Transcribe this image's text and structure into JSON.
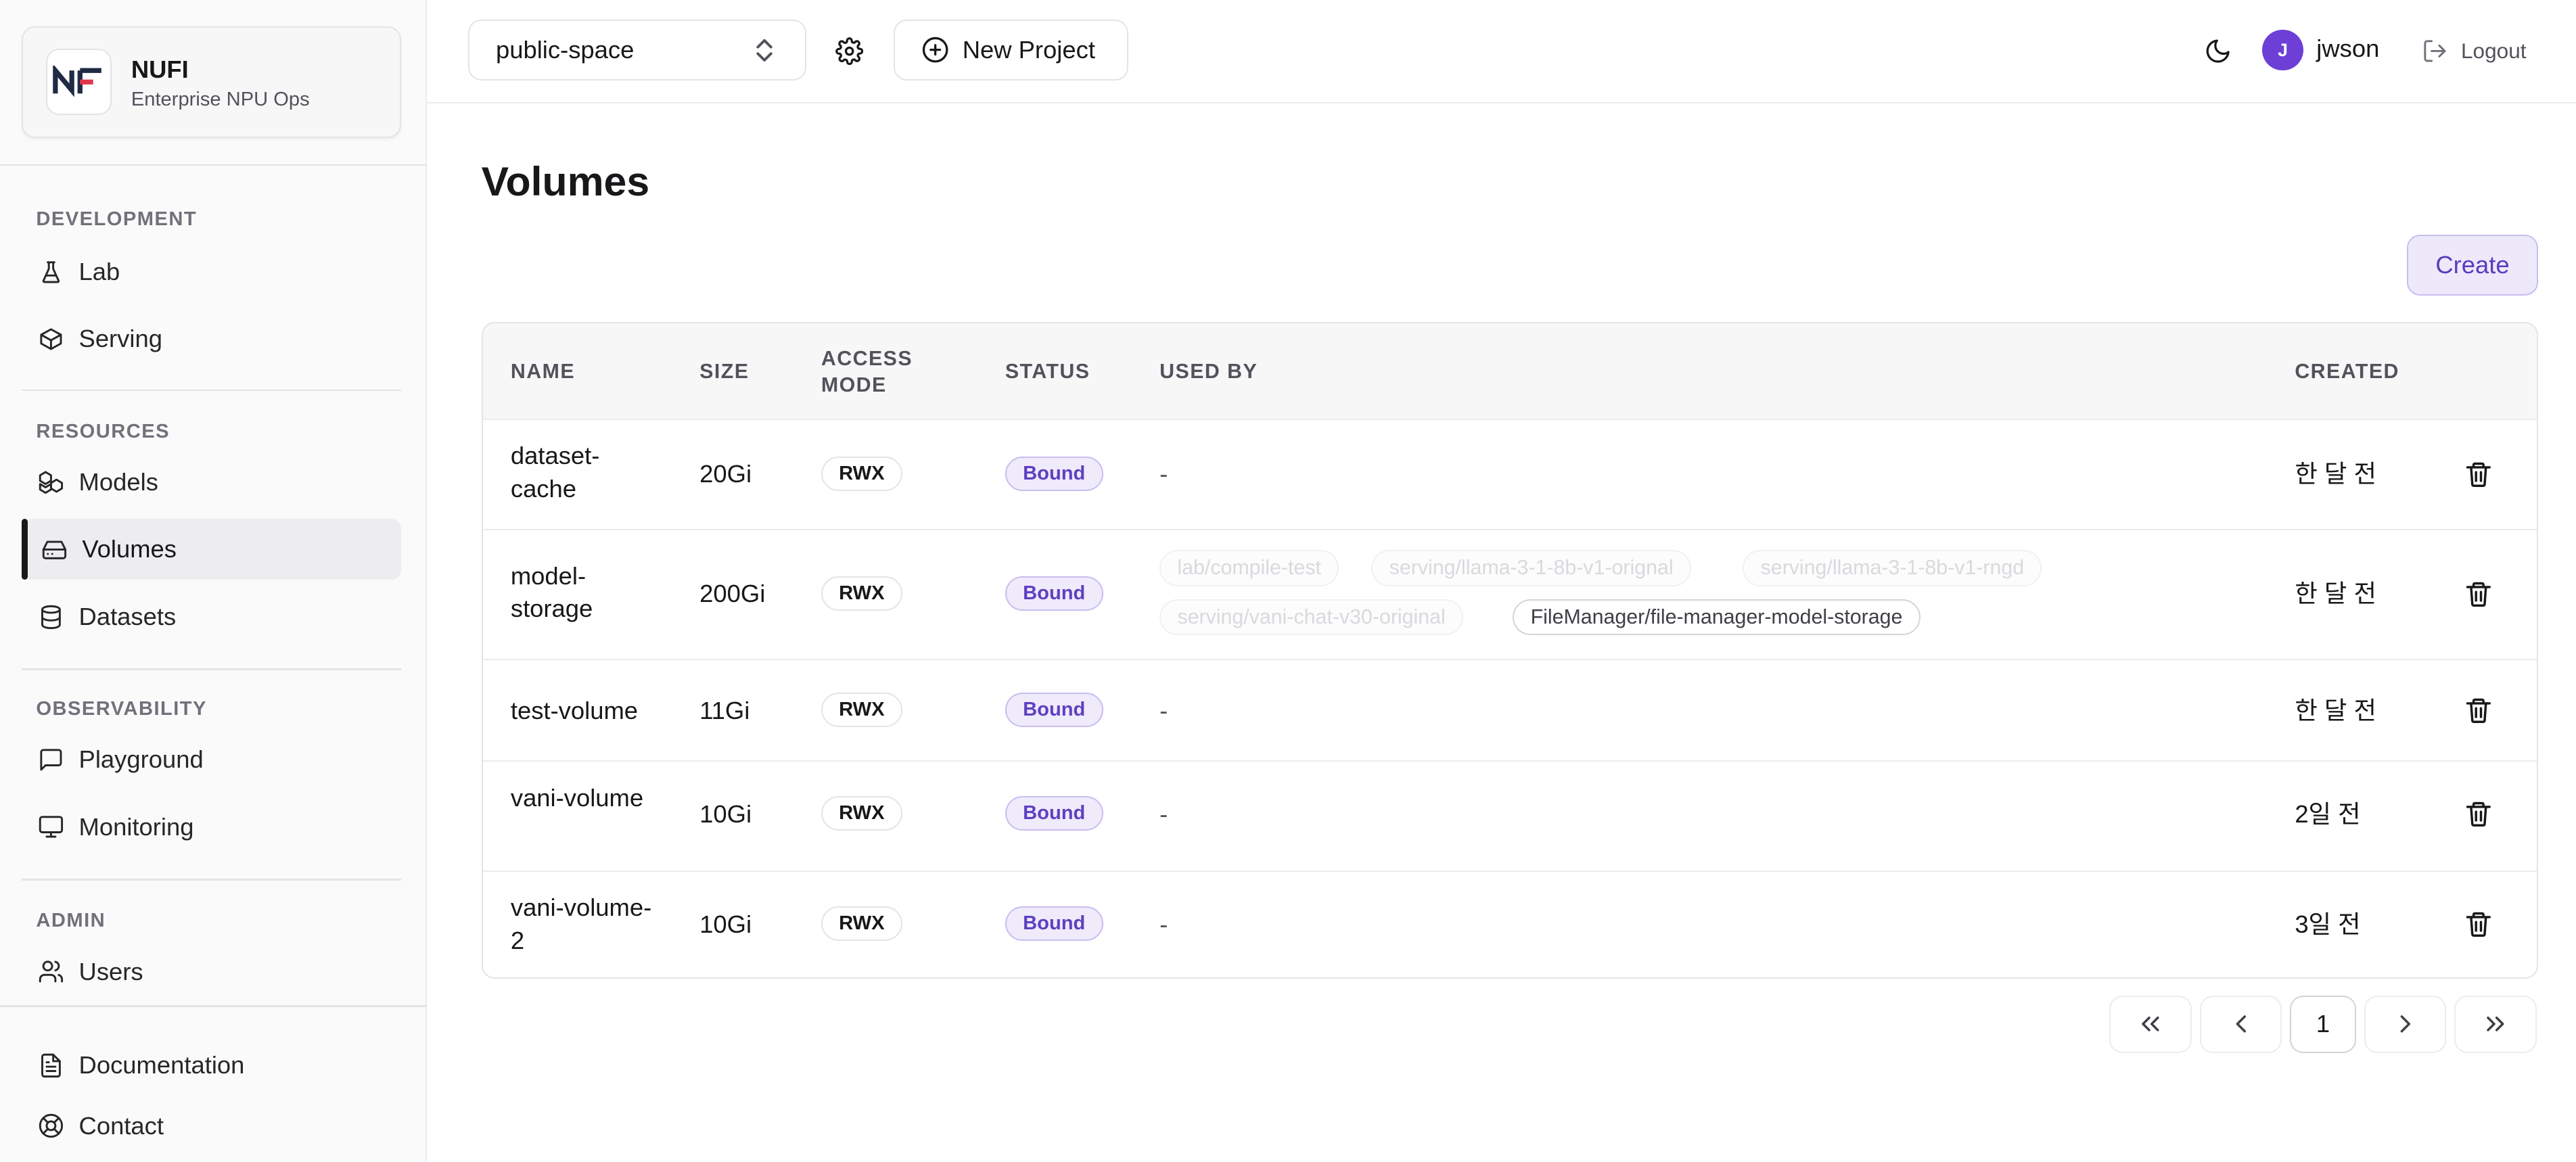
{
  "brand": {
    "logo_text": "NF",
    "name": "NUFI",
    "subtitle": "Enterprise NPU Ops"
  },
  "sidebar": {
    "sections": [
      {
        "label": "DEVELOPMENT",
        "items": [
          {
            "label": "Lab",
            "icon": "flask-icon"
          },
          {
            "label": "Serving",
            "icon": "box-icon"
          }
        ]
      },
      {
        "label": "RESOURCES",
        "items": [
          {
            "label": "Models",
            "icon": "boxes-icon"
          },
          {
            "label": "Volumes",
            "icon": "hard-drive-icon",
            "active": true
          },
          {
            "label": "Datasets",
            "icon": "database-icon"
          }
        ]
      },
      {
        "label": "OBSERVABILITY",
        "items": [
          {
            "label": "Playground",
            "icon": "message-square-icon"
          },
          {
            "label": "Monitoring",
            "icon": "monitor-icon"
          }
        ]
      },
      {
        "label": "ADMIN",
        "items": [
          {
            "label": "Users",
            "icon": "users-icon"
          }
        ]
      }
    ],
    "footer": [
      {
        "label": "Documentation",
        "icon": "file-text-icon"
      },
      {
        "label": "Contact",
        "icon": "life-buoy-icon"
      }
    ]
  },
  "header": {
    "project_select": "public-space",
    "new_project_label": "New Project",
    "avatar_initial": "J",
    "username": "jwson",
    "logout_label": "Logout"
  },
  "main": {
    "title": "Volumes",
    "create_label": "Create",
    "columns": {
      "name": "NAME",
      "size": "SIZE",
      "access_mode": "ACCESS MODE",
      "status": "STATUS",
      "used_by": "USED BY",
      "created": "CREATED"
    },
    "rows": [
      {
        "name": "dataset-cache",
        "size": "20Gi",
        "access_mode": "RWX",
        "status": "Bound",
        "used_by": "-",
        "created": "한 달 전"
      },
      {
        "name": "model-storage",
        "size": "200Gi",
        "access_mode": "RWX",
        "status": "Bound",
        "used_by_chips": [
          "lab/compile-test",
          "serving/llama-3-1-8b-v1-orignal",
          "serving/llama-3-1-8b-v1-rngd",
          "serving/vani-chat-v30-original",
          "FileManager/file-manager-model-storage"
        ],
        "created": "한 달 전"
      },
      {
        "name": "test-volume",
        "size": "11Gi",
        "access_mode": "RWX",
        "status": "Bound",
        "used_by": "-",
        "created": "한 달 전"
      },
      {
        "name": "vani-volume",
        "size": "10Gi",
        "access_mode": "RWX",
        "status": "Bound",
        "used_by": "-",
        "created": "2일 전"
      },
      {
        "name": "vani-volume-2",
        "size": "10Gi",
        "access_mode": "RWX",
        "status": "Bound",
        "used_by": "-",
        "created": "3일 전"
      }
    ],
    "pagination": {
      "current_page": "1"
    }
  },
  "colors": {
    "accent": "#6d3fd6",
    "badge_text": "#6040c0",
    "badge_bg": "#efebfb"
  }
}
